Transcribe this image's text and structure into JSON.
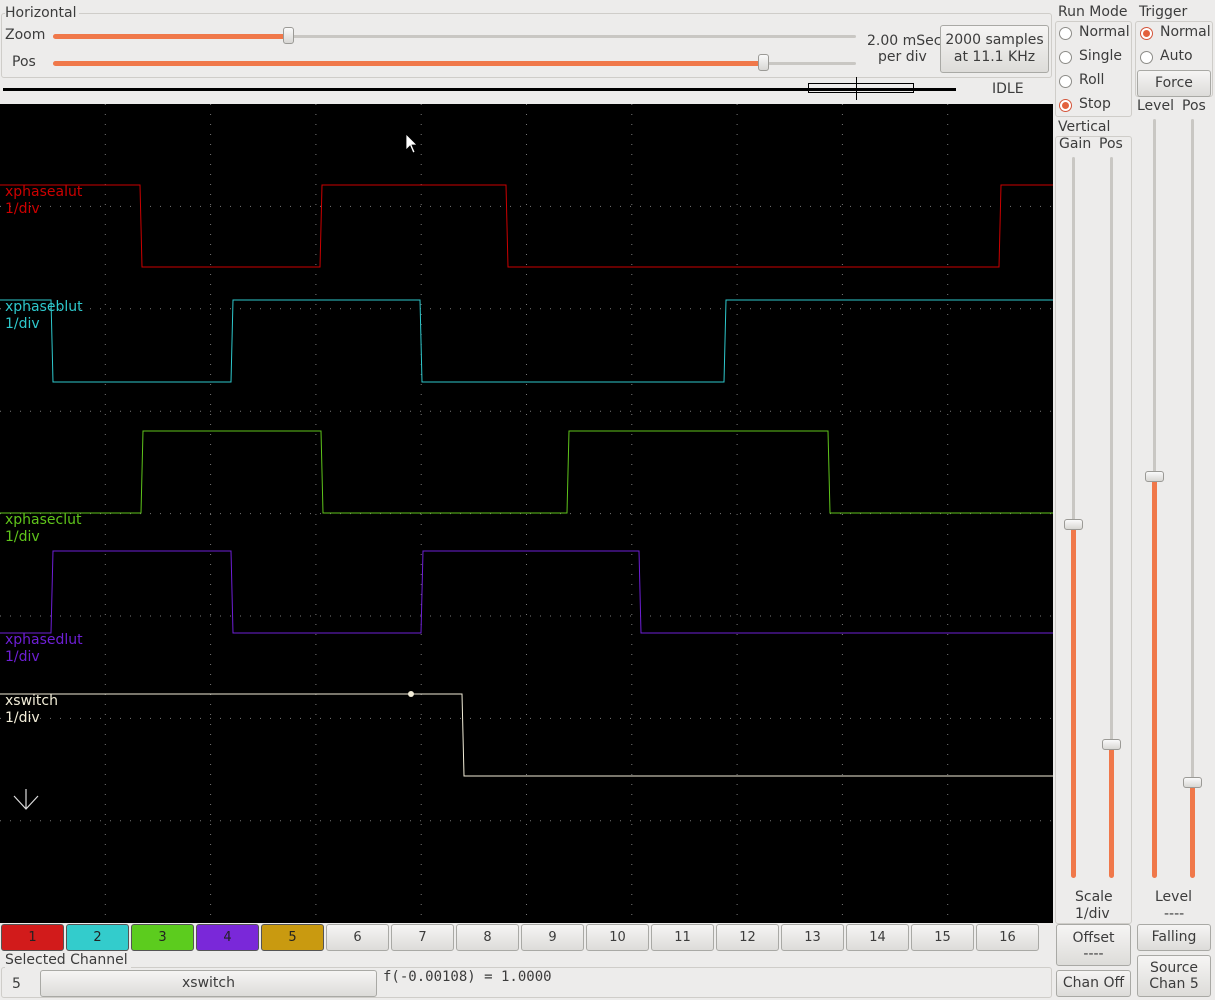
{
  "horizontal": {
    "title": "Horizontal",
    "zoom_label": "Zoom",
    "pos_label": "Pos",
    "zoom_value": 0.29,
    "pos_value": 0.89,
    "time_per_div": "2.00 mSec",
    "per_div": "per div",
    "samples_line1": "2000 samples",
    "samples_line2": "at 11.1 KHz",
    "status": "IDLE"
  },
  "run_mode": {
    "title": "Run Mode",
    "options": [
      "Normal",
      "Single",
      "Roll",
      "Stop"
    ],
    "selected": "Stop"
  },
  "trigger": {
    "title": "Trigger",
    "options": [
      "Normal",
      "Auto"
    ],
    "selected": "Normal",
    "force_label": "Force",
    "level_label": "Level",
    "pos_label": "Pos",
    "level_value": 0.53,
    "pos_value": 0.12,
    "level_readout_title": "Level",
    "level_readout_value": "----",
    "edge_button": "Falling",
    "source_line1": "Source",
    "source_line2": "Chan 5"
  },
  "vertical": {
    "title": "Vertical",
    "gain_label": "Gain",
    "pos_label": "Pos",
    "gain_value": 0.49,
    "pos_value": 0.18,
    "scale_title": "Scale",
    "scale_value": "1/div",
    "offset_label": "Offset",
    "offset_value": "----",
    "chan_off_label": "Chan Off"
  },
  "channels": [
    {
      "name": "xphasealut",
      "scale": "1/div",
      "color": "#cc0000"
    },
    {
      "name": "xphaseblut",
      "scale": "1/div",
      "color": "#2ec8cc"
    },
    {
      "name": "xphaseclut",
      "scale": "1/div",
      "color": "#5fc41b"
    },
    {
      "name": "xphasedlut",
      "scale": "1/div",
      "color": "#6e1fd6"
    },
    {
      "name": "xswitch",
      "scale": "1/div",
      "color": "#f2edd8"
    }
  ],
  "channel_buttons": [
    {
      "label": "1",
      "color": "#d21b1b"
    },
    {
      "label": "2",
      "color": "#33cccc"
    },
    {
      "label": "3",
      "color": "#5ccc1e"
    },
    {
      "label": "4",
      "color": "#7a28d9"
    },
    {
      "label": "5",
      "color": "#c99a10"
    },
    {
      "label": "6"
    },
    {
      "label": "7"
    },
    {
      "label": "8"
    },
    {
      "label": "9"
    },
    {
      "label": "10"
    },
    {
      "label": "11"
    },
    {
      "label": "12"
    },
    {
      "label": "13"
    },
    {
      "label": "14"
    },
    {
      "label": "15"
    },
    {
      "label": "16"
    }
  ],
  "selected_channel": {
    "title": "Selected Channel",
    "number": "5",
    "name": "xswitch",
    "readout": "f(-0.00108) =  1.0000"
  }
}
